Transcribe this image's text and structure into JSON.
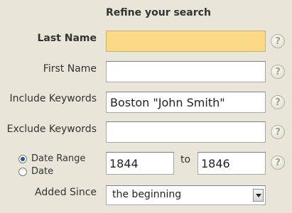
{
  "heading": "Refine your search",
  "fields": {
    "last_name": {
      "label": "Last Name",
      "value": ""
    },
    "first_name": {
      "label": "First Name",
      "value": ""
    },
    "include_keywords": {
      "label": "Include Keywords",
      "value": "Boston \"John Smith\""
    },
    "exclude_keywords": {
      "label": "Exclude Keywords",
      "value": ""
    }
  },
  "date": {
    "range_label": "Date Range",
    "single_label": "Date",
    "selected": "Date Range",
    "from": "1844",
    "to_label": "to",
    "to": "1846"
  },
  "added_since": {
    "label": "Added Since",
    "selected": "the beginning"
  },
  "help_glyph": "?",
  "icons": {
    "help": "help-icon",
    "dropdown": "chevron-down-icon"
  },
  "colors": {
    "background": "#e9e5d8",
    "highlight": "#fbd987"
  }
}
